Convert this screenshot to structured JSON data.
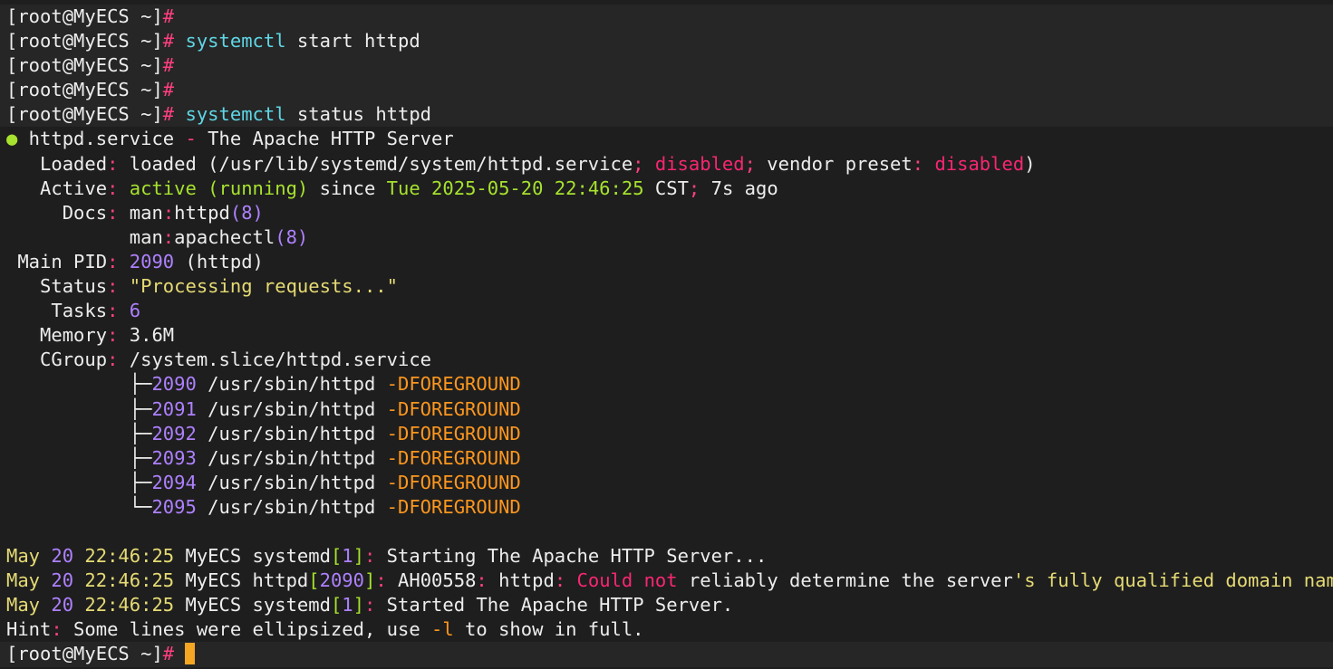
{
  "colors": {
    "background": "#1e1e1e",
    "prompt_band": "#262626",
    "text": "#ededed",
    "cyan": "#5fd7e6",
    "pink": "#ff3f7f",
    "green": "#a6e22e",
    "yellow": "#e6db74",
    "purple": "#ae81ff",
    "orange": "#fd971f",
    "red": "#f92672",
    "cursor": "#f5a623"
  },
  "terminal": {
    "lines": [
      {
        "prompt": true,
        "segments": [
          {
            "t": "[root@MyECS ~]",
            "c": "text"
          },
          {
            "t": "#",
            "c": "pink"
          }
        ]
      },
      {
        "prompt": true,
        "segments": [
          {
            "t": "[root@MyECS ~]",
            "c": "text"
          },
          {
            "t": "#",
            "c": "pink"
          },
          {
            "t": " ",
            "c": "text"
          },
          {
            "t": "systemctl",
            "c": "cyan"
          },
          {
            "t": " start httpd",
            "c": "text"
          }
        ]
      },
      {
        "prompt": true,
        "segments": [
          {
            "t": "[root@MyECS ~]",
            "c": "text"
          },
          {
            "t": "#",
            "c": "pink"
          }
        ]
      },
      {
        "prompt": true,
        "segments": [
          {
            "t": "[root@MyECS ~]",
            "c": "text"
          },
          {
            "t": "#",
            "c": "pink"
          }
        ]
      },
      {
        "prompt": true,
        "segments": [
          {
            "t": "[root@MyECS ~]",
            "c": "text"
          },
          {
            "t": "#",
            "c": "pink"
          },
          {
            "t": " ",
            "c": "text"
          },
          {
            "t": "systemctl",
            "c": "cyan"
          },
          {
            "t": " status httpd",
            "c": "text"
          }
        ]
      },
      {
        "prompt": false,
        "segments": [
          {
            "t": "●",
            "c": "green"
          },
          {
            "t": " httpd.service ",
            "c": "text"
          },
          {
            "t": "-",
            "c": "pink"
          },
          {
            "t": " The Apache HTTP Server",
            "c": "text"
          }
        ]
      },
      {
        "prompt": false,
        "segments": [
          {
            "t": "   Loaded",
            "c": "text"
          },
          {
            "t": ":",
            "c": "pink"
          },
          {
            "t": " loaded (/usr/lib/systemd/system/httpd.service",
            "c": "text"
          },
          {
            "t": ";",
            "c": "pink"
          },
          {
            "t": " ",
            "c": "text"
          },
          {
            "t": "disabled",
            "c": "red"
          },
          {
            "t": ";",
            "c": "pink"
          },
          {
            "t": " vendor preset",
            "c": "text"
          },
          {
            "t": ":",
            "c": "pink"
          },
          {
            "t": " ",
            "c": "text"
          },
          {
            "t": "disabled",
            "c": "red"
          },
          {
            "t": ")",
            "c": "text"
          }
        ]
      },
      {
        "prompt": false,
        "segments": [
          {
            "t": "   Active",
            "c": "text"
          },
          {
            "t": ":",
            "c": "pink"
          },
          {
            "t": " ",
            "c": "text"
          },
          {
            "t": "active (running)",
            "c": "green"
          },
          {
            "t": " since ",
            "c": "text"
          },
          {
            "t": "Tue 2025-05-20 22:46:25",
            "c": "green"
          },
          {
            "t": " CST",
            "c": "text"
          },
          {
            "t": ";",
            "c": "pink"
          },
          {
            "t": " 7s ago",
            "c": "text"
          }
        ]
      },
      {
        "prompt": false,
        "segments": [
          {
            "t": "     Docs",
            "c": "text"
          },
          {
            "t": ":",
            "c": "pink"
          },
          {
            "t": " man",
            "c": "text"
          },
          {
            "t": ":",
            "c": "pink"
          },
          {
            "t": "httpd",
            "c": "text"
          },
          {
            "t": "(8)",
            "c": "purple"
          }
        ]
      },
      {
        "prompt": false,
        "segments": [
          {
            "t": "           man",
            "c": "text"
          },
          {
            "t": ":",
            "c": "pink"
          },
          {
            "t": "apachectl",
            "c": "text"
          },
          {
            "t": "(8)",
            "c": "purple"
          }
        ]
      },
      {
        "prompt": false,
        "segments": [
          {
            "t": " Main PID",
            "c": "text"
          },
          {
            "t": ":",
            "c": "pink"
          },
          {
            "t": " ",
            "c": "text"
          },
          {
            "t": "2090",
            "c": "purple"
          },
          {
            "t": " (httpd)",
            "c": "text"
          }
        ]
      },
      {
        "prompt": false,
        "segments": [
          {
            "t": "   Status",
            "c": "text"
          },
          {
            "t": ":",
            "c": "pink"
          },
          {
            "t": " ",
            "c": "text"
          },
          {
            "t": "\"Processing requests...\"",
            "c": "yellow"
          }
        ]
      },
      {
        "prompt": false,
        "segments": [
          {
            "t": "    Tasks",
            "c": "text"
          },
          {
            "t": ":",
            "c": "pink"
          },
          {
            "t": " ",
            "c": "text"
          },
          {
            "t": "6",
            "c": "purple"
          }
        ]
      },
      {
        "prompt": false,
        "segments": [
          {
            "t": "   Memory",
            "c": "text"
          },
          {
            "t": ":",
            "c": "pink"
          },
          {
            "t": " 3.6M",
            "c": "text"
          }
        ]
      },
      {
        "prompt": false,
        "segments": [
          {
            "t": "   CGroup",
            "c": "text"
          },
          {
            "t": ":",
            "c": "pink"
          },
          {
            "t": " /system.slice/httpd.service",
            "c": "text"
          }
        ]
      },
      {
        "prompt": false,
        "segments": [
          {
            "t": "           ├─",
            "c": "text"
          },
          {
            "t": "2090",
            "c": "purple"
          },
          {
            "t": " /usr/sbin/httpd ",
            "c": "text"
          },
          {
            "t": "-DFOREGROUND",
            "c": "orange"
          }
        ]
      },
      {
        "prompt": false,
        "segments": [
          {
            "t": "           ├─",
            "c": "text"
          },
          {
            "t": "2091",
            "c": "purple"
          },
          {
            "t": " /usr/sbin/httpd ",
            "c": "text"
          },
          {
            "t": "-DFOREGROUND",
            "c": "orange"
          }
        ]
      },
      {
        "prompt": false,
        "segments": [
          {
            "t": "           ├─",
            "c": "text"
          },
          {
            "t": "2092",
            "c": "purple"
          },
          {
            "t": " /usr/sbin/httpd ",
            "c": "text"
          },
          {
            "t": "-DFOREGROUND",
            "c": "orange"
          }
        ]
      },
      {
        "prompt": false,
        "segments": [
          {
            "t": "           ├─",
            "c": "text"
          },
          {
            "t": "2093",
            "c": "purple"
          },
          {
            "t": " /usr/sbin/httpd ",
            "c": "text"
          },
          {
            "t": "-DFOREGROUND",
            "c": "orange"
          }
        ]
      },
      {
        "prompt": false,
        "segments": [
          {
            "t": "           ├─",
            "c": "text"
          },
          {
            "t": "2094",
            "c": "purple"
          },
          {
            "t": " /usr/sbin/httpd ",
            "c": "text"
          },
          {
            "t": "-DFOREGROUND",
            "c": "orange"
          }
        ]
      },
      {
        "prompt": false,
        "segments": [
          {
            "t": "           └─",
            "c": "text"
          },
          {
            "t": "2095",
            "c": "purple"
          },
          {
            "t": " /usr/sbin/httpd ",
            "c": "text"
          },
          {
            "t": "-DFOREGROUND",
            "c": "orange"
          }
        ]
      },
      {
        "prompt": false,
        "segments": []
      },
      {
        "prompt": false,
        "segments": [
          {
            "t": "May ",
            "c": "yellow"
          },
          {
            "t": "20",
            "c": "purple"
          },
          {
            "t": " 22:46:25",
            "c": "yellow"
          },
          {
            "t": " MyECS systemd",
            "c": "text"
          },
          {
            "t": "[",
            "c": "green"
          },
          {
            "t": "1",
            "c": "purple"
          },
          {
            "t": "]",
            "c": "green"
          },
          {
            "t": ":",
            "c": "pink"
          },
          {
            "t": " Starting The Apache HTTP Server...",
            "c": "text"
          }
        ]
      },
      {
        "prompt": false,
        "segments": [
          {
            "t": "May ",
            "c": "yellow"
          },
          {
            "t": "20",
            "c": "purple"
          },
          {
            "t": " 22:46:25",
            "c": "yellow"
          },
          {
            "t": " MyECS httpd",
            "c": "text"
          },
          {
            "t": "[",
            "c": "green"
          },
          {
            "t": "2090",
            "c": "purple"
          },
          {
            "t": "]",
            "c": "green"
          },
          {
            "t": ":",
            "c": "pink"
          },
          {
            "t": " AH00558",
            "c": "text"
          },
          {
            "t": ":",
            "c": "pink"
          },
          {
            "t": " httpd",
            "c": "text"
          },
          {
            "t": ":",
            "c": "pink"
          },
          {
            "t": " ",
            "c": "text"
          },
          {
            "t": "Could not",
            "c": "red"
          },
          {
            "t": " reliably determine the server",
            "c": "text"
          },
          {
            "t": "'s fully qualified domain name, usin",
            "c": "yellow"
          }
        ]
      },
      {
        "prompt": false,
        "segments": [
          {
            "t": "May ",
            "c": "yellow"
          },
          {
            "t": "20",
            "c": "purple"
          },
          {
            "t": " 22:46:25",
            "c": "yellow"
          },
          {
            "t": " MyECS systemd",
            "c": "text"
          },
          {
            "t": "[",
            "c": "green"
          },
          {
            "t": "1",
            "c": "purple"
          },
          {
            "t": "]",
            "c": "green"
          },
          {
            "t": ":",
            "c": "pink"
          },
          {
            "t": " Started The Apache HTTP Server.",
            "c": "text"
          }
        ]
      },
      {
        "prompt": false,
        "segments": [
          {
            "t": "Hint",
            "c": "text"
          },
          {
            "t": ":",
            "c": "pink"
          },
          {
            "t": " Some lines were ellipsized, use ",
            "c": "text"
          },
          {
            "t": "-l",
            "c": "orange"
          },
          {
            "t": " to show in full.",
            "c": "text"
          }
        ]
      },
      {
        "prompt": true,
        "cursor": true,
        "segments": [
          {
            "t": "[root@MyECS ~]",
            "c": "text"
          },
          {
            "t": "#",
            "c": "pink"
          },
          {
            "t": " ",
            "c": "text"
          }
        ]
      }
    ]
  }
}
